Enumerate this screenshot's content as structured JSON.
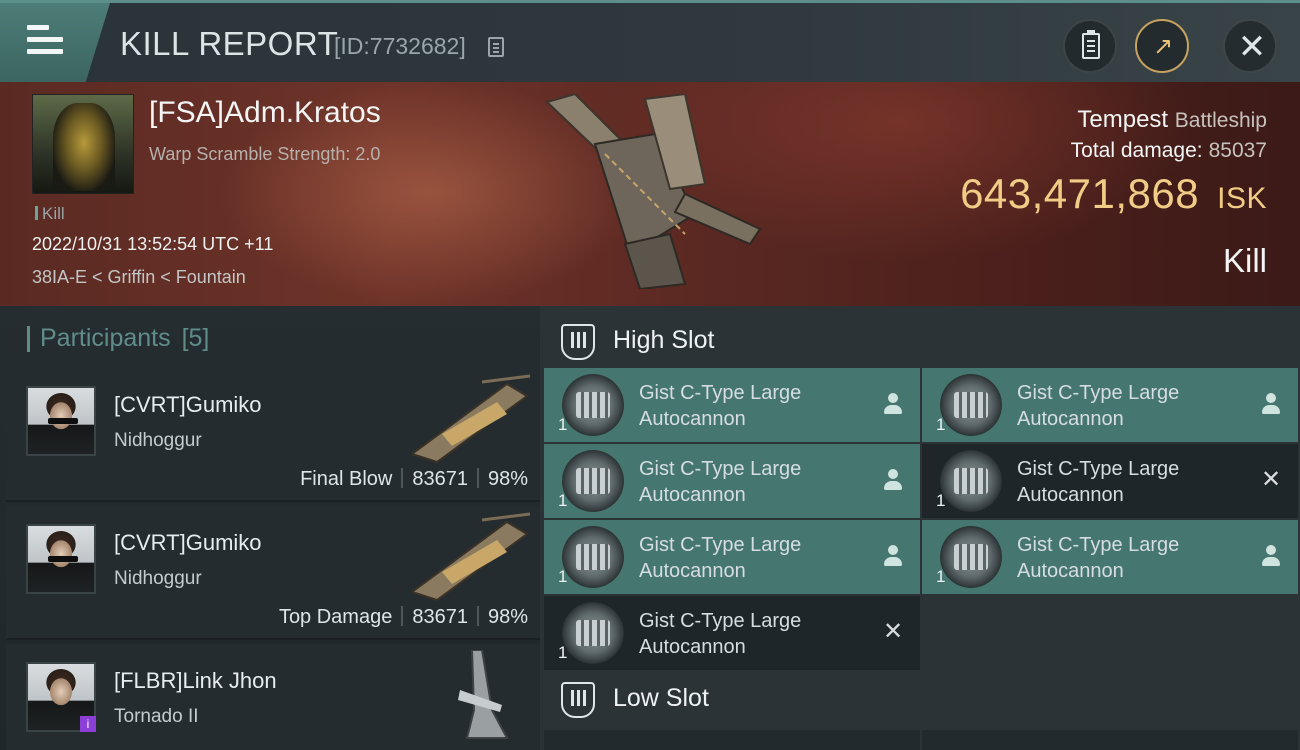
{
  "header": {
    "title": "KILL REPORT",
    "report_id": "[ID:7732682]",
    "icons": [
      "menu-icon",
      "copy-icon",
      "clipboard-icon",
      "share-icon",
      "close-icon"
    ]
  },
  "victim": {
    "name": "[FSA]Adm.Kratos",
    "scramble": "Warp Scramble Strength: 2.0",
    "tag": "Kill",
    "date": "2022/10/31 13:52:54 UTC +11",
    "location": "38IA-E < Griffin < Fountain",
    "ship_name": "Tempest",
    "ship_class": "Battleship",
    "total_damage_label": "Total damage:",
    "total_damage": "85037",
    "isk_value": "643,471,868",
    "isk_unit": "ISK",
    "result": "Kill"
  },
  "participants": {
    "label": "Participants",
    "count": "[5]",
    "rows": [
      {
        "name": "[CVRT]Gumiko",
        "ship": "Nidhoggur",
        "role": "Final Blow",
        "damage": "83671",
        "percent": "98%"
      },
      {
        "name": "[CVRT]Gumiko",
        "ship": "Nidhoggur",
        "role": "Top Damage",
        "damage": "83671",
        "percent": "98%"
      },
      {
        "name": "[FLBR]Link Jhon",
        "ship": "Tornado II",
        "badge": "i"
      }
    ]
  },
  "slots": {
    "high_label": "High Slot",
    "low_label": "Low Slot",
    "high_modules": [
      {
        "name": "Gist C-Type Large Autocannon",
        "qty": "1",
        "status": "dropped"
      },
      {
        "name": "Gist C-Type Large Autocannon",
        "qty": "1",
        "status": "dropped"
      },
      {
        "name": "Gist C-Type Large Autocannon",
        "qty": "1",
        "status": "dropped"
      },
      {
        "name": "Gist C-Type Large Autocannon",
        "qty": "1",
        "status": "destroyed"
      },
      {
        "name": "Gist C-Type Large Autocannon",
        "qty": "1",
        "status": "dropped"
      },
      {
        "name": "Gist C-Type Large Autocannon",
        "qty": "1",
        "status": "dropped"
      },
      {
        "name": "Gist C-Type Large Autocannon",
        "qty": "1",
        "status": "destroyed"
      }
    ]
  },
  "colors": {
    "accent": "#5f8d88",
    "dropped_bg": "#467670",
    "destroyed_bg": "#1f2629",
    "isk": "#f0cc86",
    "banner": "#6e3329"
  }
}
